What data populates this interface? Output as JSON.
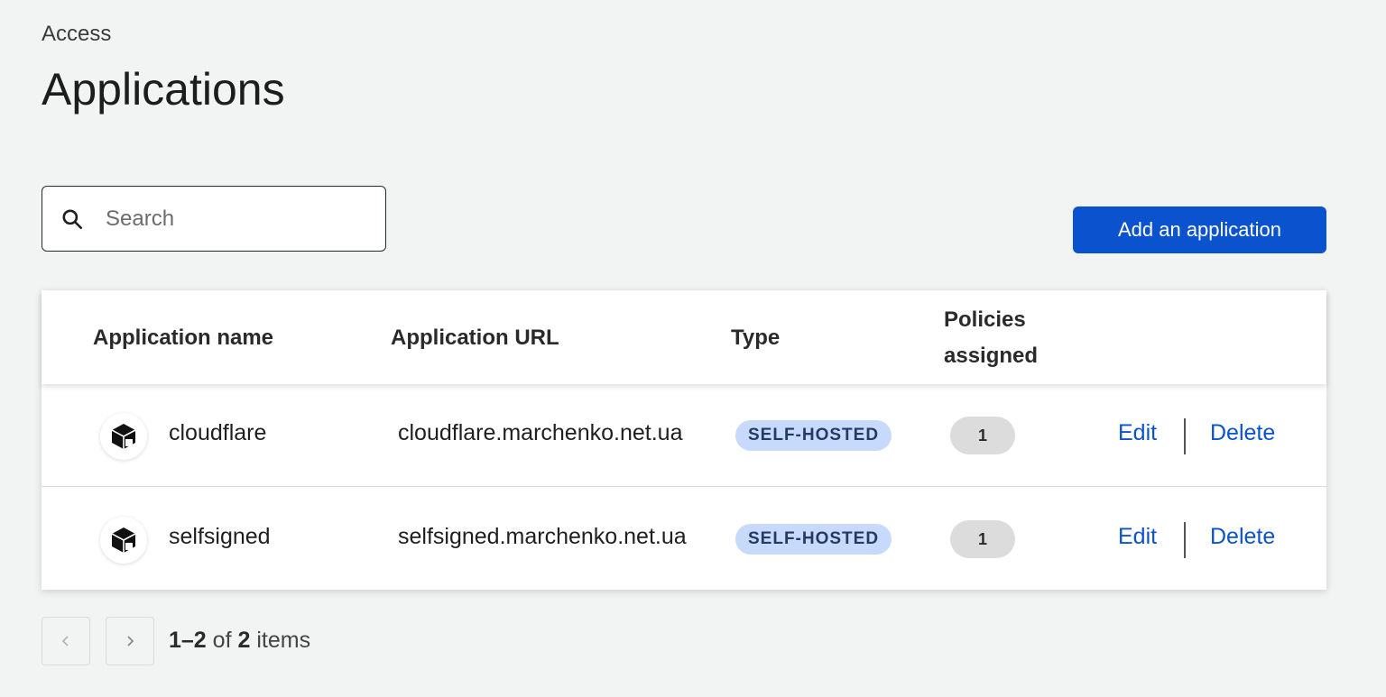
{
  "breadcrumb": "Access",
  "page_title": "Applications",
  "search": {
    "placeholder": "Search",
    "icon": "search-icon"
  },
  "add_button_label": "Add an application",
  "table": {
    "columns": [
      "Application name",
      "Application URL",
      "Type",
      "Policies assigned"
    ],
    "rows": [
      {
        "name": "cloudflare",
        "url": "cloudflare.marchenko.net.ua",
        "type": "SELF-HOSTED",
        "policies": "1",
        "edit": "Edit",
        "delete": "Delete",
        "icon": "cube-icon"
      },
      {
        "name": "selfsigned",
        "url": "selfsigned.marchenko.net.ua",
        "type": "SELF-HOSTED",
        "policies": "1",
        "edit": "Edit",
        "delete": "Delete",
        "icon": "cube-icon"
      }
    ]
  },
  "pagination": {
    "range": "1–2",
    "of": "of",
    "total": "2",
    "items": "items"
  },
  "colors": {
    "accent": "#0b53ce",
    "badge_bg": "#c7dafb",
    "background": "#f2f3f3"
  }
}
